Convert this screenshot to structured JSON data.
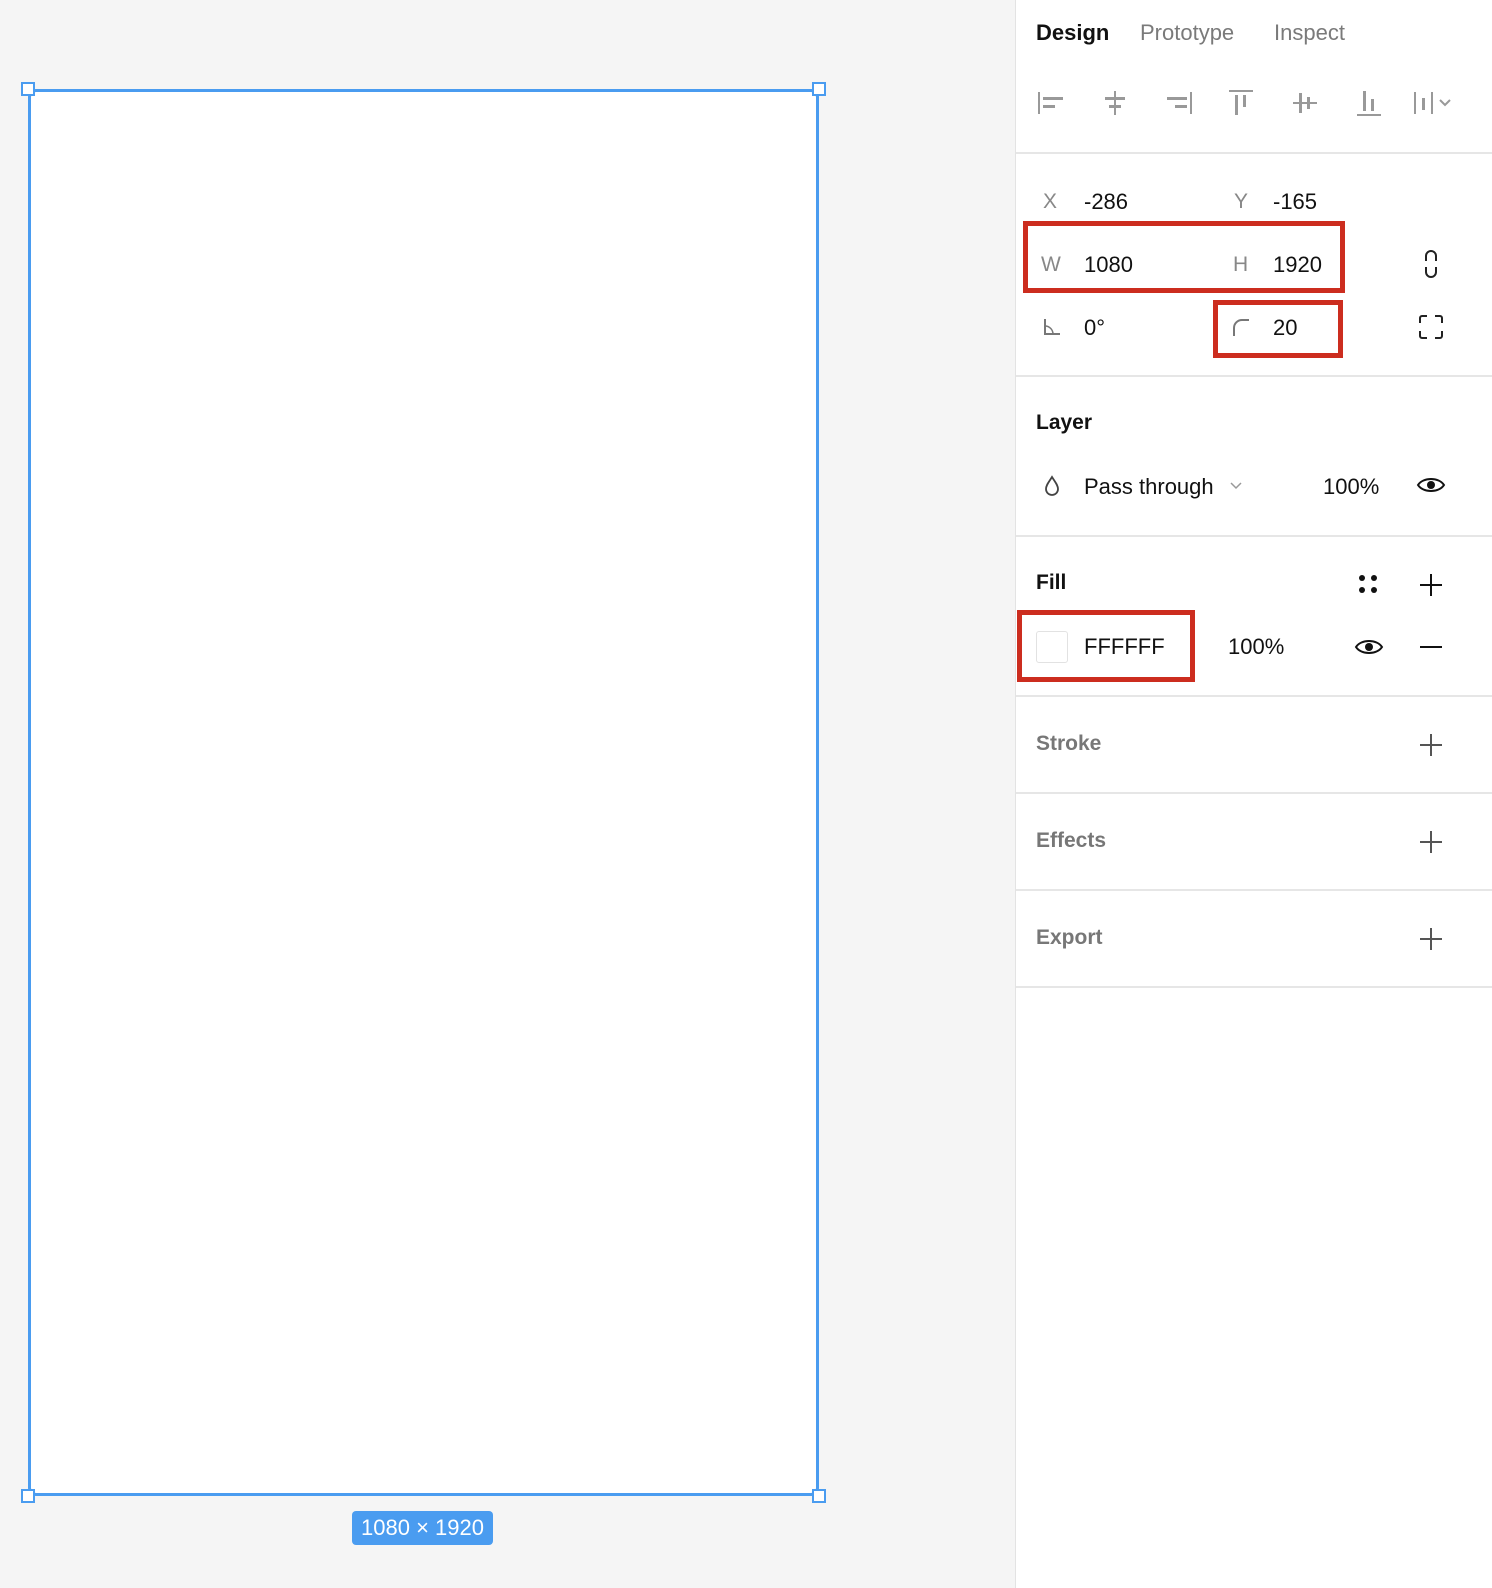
{
  "canvas": {
    "frame_size_label": "1080 × 1920"
  },
  "panel": {
    "tabs": [
      {
        "label": "Design"
      },
      {
        "label": "Prototype"
      },
      {
        "label": "Inspect"
      }
    ],
    "alignment_icons": [
      "align-left-icon",
      "align-horizontal-center-icon",
      "align-right-icon",
      "align-top-icon",
      "align-vertical-center-icon",
      "align-bottom-icon",
      "distribute-icon"
    ],
    "position": {
      "x_label": "X",
      "x_value": "-286",
      "y_label": "Y",
      "y_value": "-165",
      "w_label": "W",
      "w_value": "1080",
      "h_label": "H",
      "h_value": "1920",
      "rotation_value": "0°",
      "radius_value": "20"
    },
    "layer": {
      "title": "Layer",
      "blend_mode": "Pass through",
      "opacity": "100%"
    },
    "fill": {
      "title": "Fill",
      "hex": "FFFFFF",
      "opacity": "100%",
      "color": "#FFFFFF"
    },
    "stroke": {
      "title": "Stroke"
    },
    "effects": {
      "title": "Effects"
    },
    "export": {
      "title": "Export"
    },
    "highlight_color": "#CC2D1F",
    "selection_color": "#4A9CF0"
  }
}
